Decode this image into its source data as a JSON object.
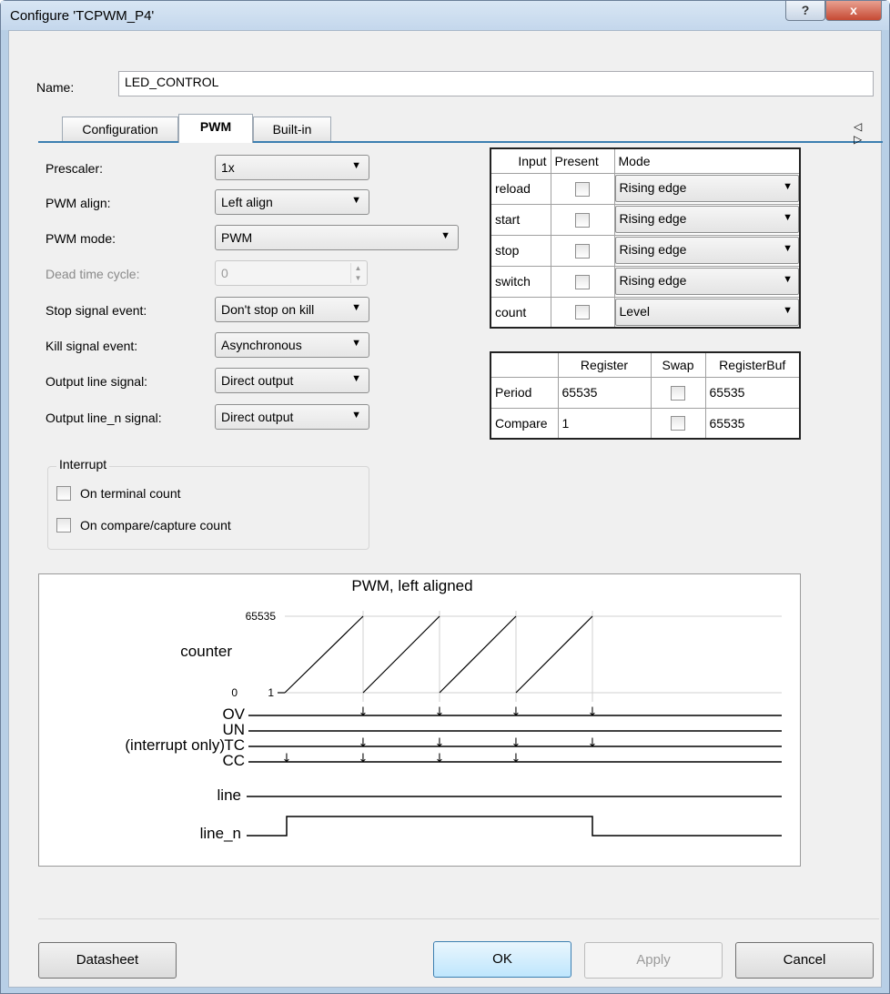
{
  "window": {
    "title": "Configure 'TCPWM_P4'",
    "help_label": "?",
    "close_label": "x"
  },
  "name": {
    "label": "Name:",
    "value": "LED_CONTROL"
  },
  "tabs": [
    {
      "label": "Configuration"
    },
    {
      "label": "PWM"
    },
    {
      "label": "Built-in"
    }
  ],
  "tab_nav": "◁ ▷",
  "fields": [
    {
      "label": "Prescaler:",
      "value": "1x"
    },
    {
      "label": "PWM align:",
      "value": "Left align"
    },
    {
      "label": "PWM mode:",
      "value": "PWM"
    },
    {
      "label": "Dead time cycle:",
      "value": "0"
    },
    {
      "label": "Stop signal event:",
      "value": "Don't stop on kill"
    },
    {
      "label": "Kill signal event:",
      "value": "Asynchronous"
    },
    {
      "label": "Output line signal:",
      "value": "Direct output"
    },
    {
      "label": "Output line_n signal:",
      "value": "Direct output"
    }
  ],
  "interrupt": {
    "title": "Interrupt",
    "options": [
      {
        "label": "On terminal count",
        "checked": false
      },
      {
        "label": "On compare/capture count",
        "checked": false
      }
    ]
  },
  "inputs_table": {
    "headers": [
      "Input",
      "Present",
      "Mode"
    ],
    "rows": [
      {
        "input": "reload",
        "present": false,
        "mode": "Rising edge"
      },
      {
        "input": "start",
        "present": false,
        "mode": "Rising edge"
      },
      {
        "input": "stop",
        "present": false,
        "mode": "Rising edge"
      },
      {
        "input": "switch",
        "present": false,
        "mode": "Rising edge"
      },
      {
        "input": "count",
        "present": false,
        "mode": "Level"
      }
    ]
  },
  "registers_table": {
    "headers": [
      "",
      "Register",
      "Swap",
      "RegisterBuf"
    ],
    "rows": [
      {
        "name": "Period",
        "register": "65535",
        "swap": false,
        "buf": "65535"
      },
      {
        "name": "Compare",
        "register": "1",
        "swap": false,
        "buf": "65535"
      }
    ]
  },
  "diagram": {
    "title": "PWM, left aligned",
    "counter_label": "counter",
    "max_label": "65535",
    "zero_label": "0",
    "one_label": "1",
    "signals": [
      "OV",
      "UN",
      "TC",
      "CC"
    ],
    "interrupt_only_label": "(interrupt only)",
    "line_label": "line",
    "line_n_label": "line_n"
  },
  "buttons": {
    "datasheet": "Datasheet",
    "ok": "OK",
    "apply": "Apply",
    "cancel": "Cancel"
  }
}
